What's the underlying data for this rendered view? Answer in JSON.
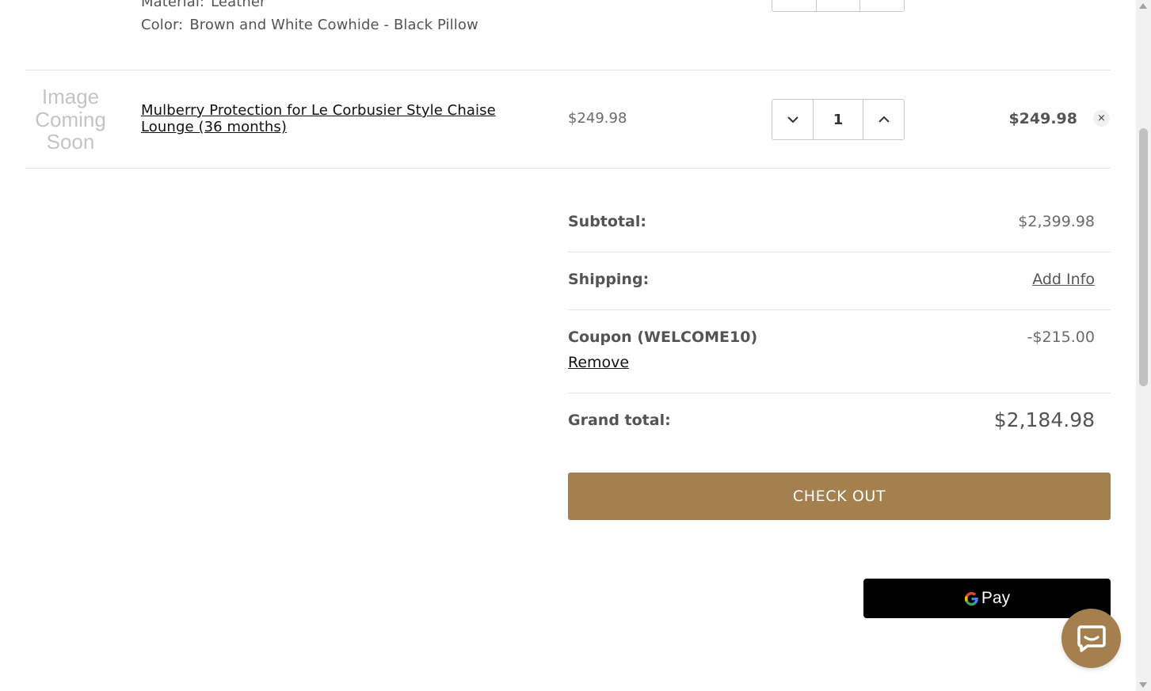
{
  "item1": {
    "material_label": "Material:",
    "material_value": "Leather",
    "color_label": "Color:",
    "color_value": "Brown and White Cowhide - Black Pillow"
  },
  "item2": {
    "placeholder_text": "Image Coming Soon",
    "placeholder_lines": [
      "Image",
      "Coming",
      "Soon"
    ],
    "name": "Mulberry Protection for Le Corbusier Style Chaise Lounge (36 months)",
    "unit_price": "$249.98",
    "quantity": "1",
    "line_total": "$249.98",
    "remove_glyph": "×"
  },
  "totals": {
    "subtotal_label": "Subtotal:",
    "subtotal_value": "$2,399.98",
    "shipping_label": "Shipping:",
    "shipping_link": "Add Info",
    "coupon_label": "Coupon (WELCOME10)",
    "coupon_value": "-$215.00",
    "coupon_remove": "Remove",
    "grand_label": "Grand total:",
    "grand_value": "$2,184.98"
  },
  "actions": {
    "checkout_label": "CHECK OUT",
    "gpay_label": "Pay"
  },
  "icons": {
    "decrease": "chevron-down-icon",
    "increase": "chevron-up-icon",
    "chat": "chat-bubble-icon",
    "google": "google-g-icon"
  },
  "colors": {
    "accent": "#a4804e",
    "gpay_bg": "#000000",
    "text": "#545454"
  }
}
